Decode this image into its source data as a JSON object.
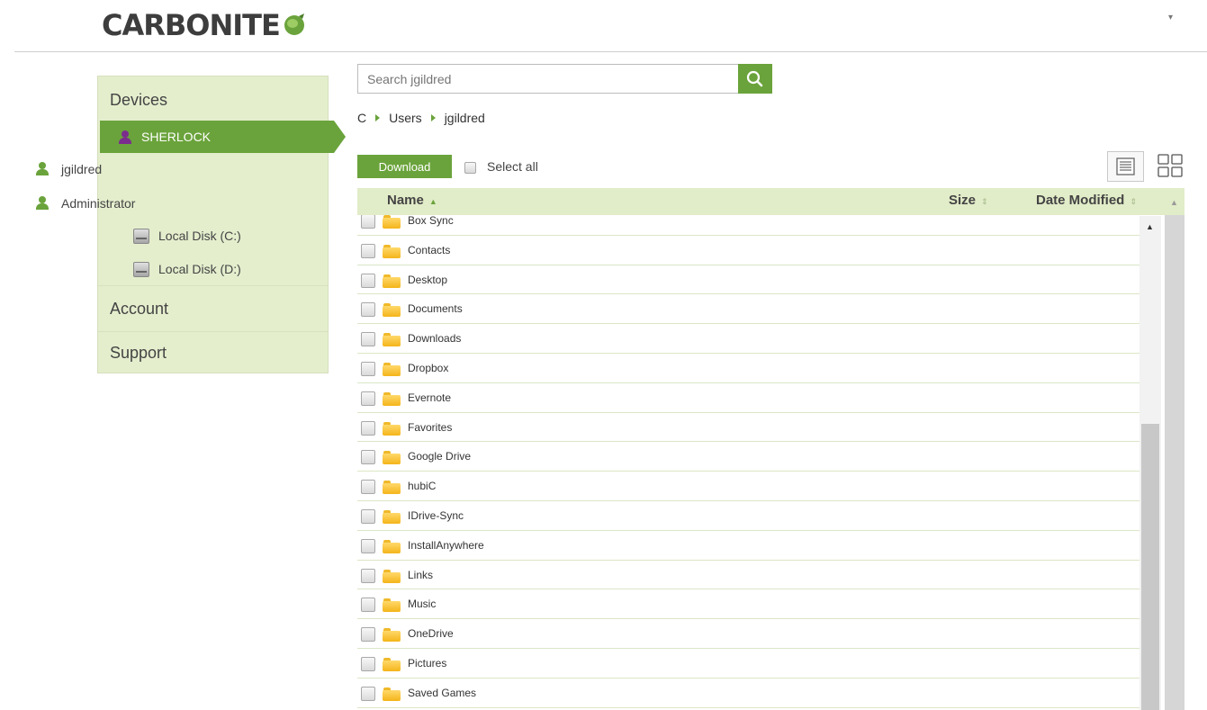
{
  "header": {
    "logo_text": "CARBONITE",
    "brand_color": "#6aa33b",
    "user_menu_caret": "▾"
  },
  "sidebar": {
    "devices_label": "Devices",
    "selected_device": "SHERLOCK",
    "items": [
      {
        "label": "jgildred",
        "icon": "user-icon"
      },
      {
        "label": "Administrator",
        "icon": "user-icon"
      },
      {
        "label": "Local Disk (C:)",
        "icon": "disk-icon"
      },
      {
        "label": "Local Disk (D:)",
        "icon": "disk-icon"
      }
    ],
    "account_label": "Account",
    "support_label": "Support"
  },
  "search": {
    "placeholder": "Search jgildred"
  },
  "breadcrumb": [
    "C",
    "Users",
    "jgildred"
  ],
  "toolbar": {
    "download_label": "Download",
    "select_all_label": "Select all"
  },
  "table": {
    "columns": [
      "Name",
      "Size",
      "Date Modified"
    ],
    "sort_column": "Name",
    "sort_direction": "ascending",
    "rows": [
      "Box Sync",
      "Contacts",
      "Desktop",
      "Documents",
      "Downloads",
      "Dropbox",
      "Evernote",
      "Favorites",
      "Google Drive",
      "hubiC",
      "IDrive-Sync",
      "InstallAnywhere",
      "Links",
      "Music",
      "OneDrive",
      "Pictures",
      "Saved Games"
    ]
  }
}
